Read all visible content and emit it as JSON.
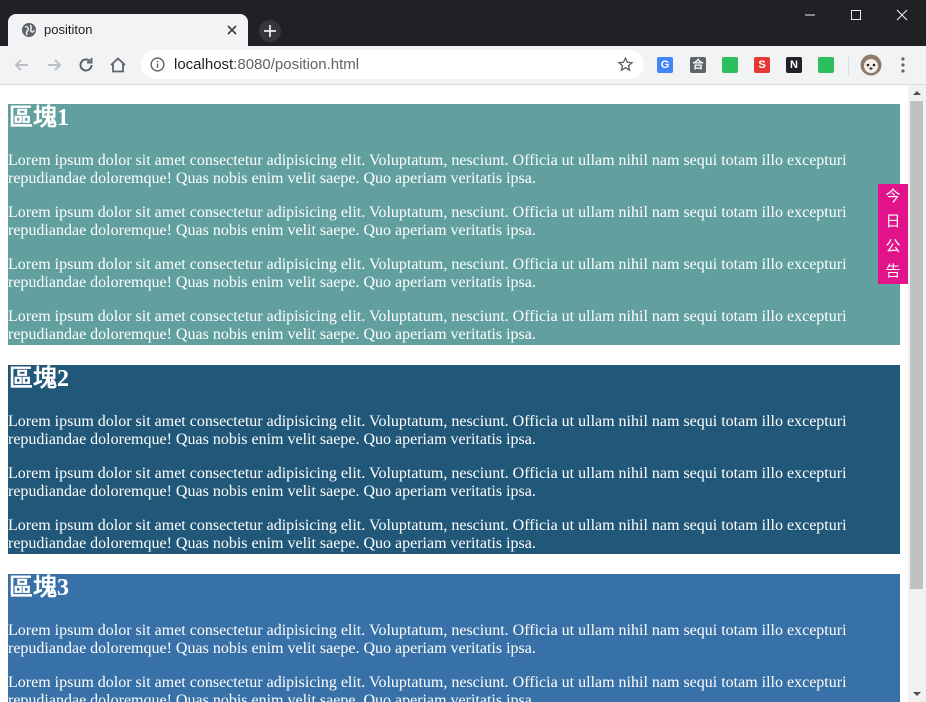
{
  "browser": {
    "tab_title": "posititon",
    "url_host": "localhost",
    "url_rest": ":8080/position.html",
    "extensions": [
      {
        "name": "translate-extension-icon",
        "color": "#4285f4",
        "glyph": "G"
      },
      {
        "name": "reader-extension-icon",
        "color": "#5f6368",
        "glyph": "合"
      },
      {
        "name": "evernote-extension-icon",
        "color": "#2dbe60",
        "glyph": ""
      },
      {
        "name": "s-extension-icon",
        "color": "#e53935",
        "glyph": "S"
      },
      {
        "name": "notion-extension-icon",
        "color": "#202124",
        "glyph": "N"
      },
      {
        "name": "clipboard-extension-icon",
        "color": "#2dbe60",
        "glyph": ""
      }
    ]
  },
  "page": {
    "blocks": [
      {
        "title": "區塊1",
        "color": "#62a0a0",
        "paragraphs": [
          "Lorem ipsum dolor sit amet consectetur adipisicing elit. Voluptatum, nesciunt. Officia ut ullam nihil nam sequi totam illo excepturi repudiandae doloremque! Quas nobis enim velit saepe. Quo aperiam veritatis ipsa.",
          "Lorem ipsum dolor sit amet consectetur adipisicing elit. Voluptatum, nesciunt. Officia ut ullam nihil nam sequi totam illo excepturi repudiandae doloremque! Quas nobis enim velit saepe. Quo aperiam veritatis ipsa.",
          "Lorem ipsum dolor sit amet consectetur adipisicing elit. Voluptatum, nesciunt. Officia ut ullam nihil nam sequi totam illo excepturi repudiandae doloremque! Quas nobis enim velit saepe. Quo aperiam veritatis ipsa.",
          "Lorem ipsum dolor sit amet consectetur adipisicing elit. Voluptatum, nesciunt. Officia ut ullam nihil nam sequi totam illo excepturi repudiandae doloremque! Quas nobis enim velit saepe. Quo aperiam veritatis ipsa."
        ]
      },
      {
        "title": "區塊2",
        "color": "#215778",
        "paragraphs": [
          "Lorem ipsum dolor sit amet consectetur adipisicing elit. Voluptatum, nesciunt. Officia ut ullam nihil nam sequi totam illo excepturi repudiandae doloremque! Quas nobis enim velit saepe. Quo aperiam veritatis ipsa.",
          "Lorem ipsum dolor sit amet consectetur adipisicing elit. Voluptatum, nesciunt. Officia ut ullam nihil nam sequi totam illo excepturi repudiandae doloremque! Quas nobis enim velit saepe. Quo aperiam veritatis ipsa.",
          "Lorem ipsum dolor sit amet consectetur adipisicing elit. Voluptatum, nesciunt. Officia ut ullam nihil nam sequi totam illo excepturi repudiandae doloremque! Quas nobis enim velit saepe. Quo aperiam veritatis ipsa."
        ]
      },
      {
        "title": "區塊3",
        "color": "#3771a7",
        "paragraphs": [
          "Lorem ipsum dolor sit amet consectetur adipisicing elit. Voluptatum, nesciunt. Officia ut ullam nihil nam sequi totam illo excepturi repudiandae doloremque! Quas nobis enim velit saepe. Quo aperiam veritatis ipsa.",
          "Lorem ipsum dolor sit amet consectetur adipisicing elit. Voluptatum, nesciunt. Officia ut ullam nihil nam sequi totam illo excepturi repudiandae doloremque! Quas nobis enim velit saepe. Quo aperiam veritatis ipsa."
        ]
      }
    ],
    "notice": {
      "label": "今日公告",
      "chars": [
        "今",
        "日",
        "公",
        "告"
      ],
      "color": "#e2138a"
    }
  }
}
